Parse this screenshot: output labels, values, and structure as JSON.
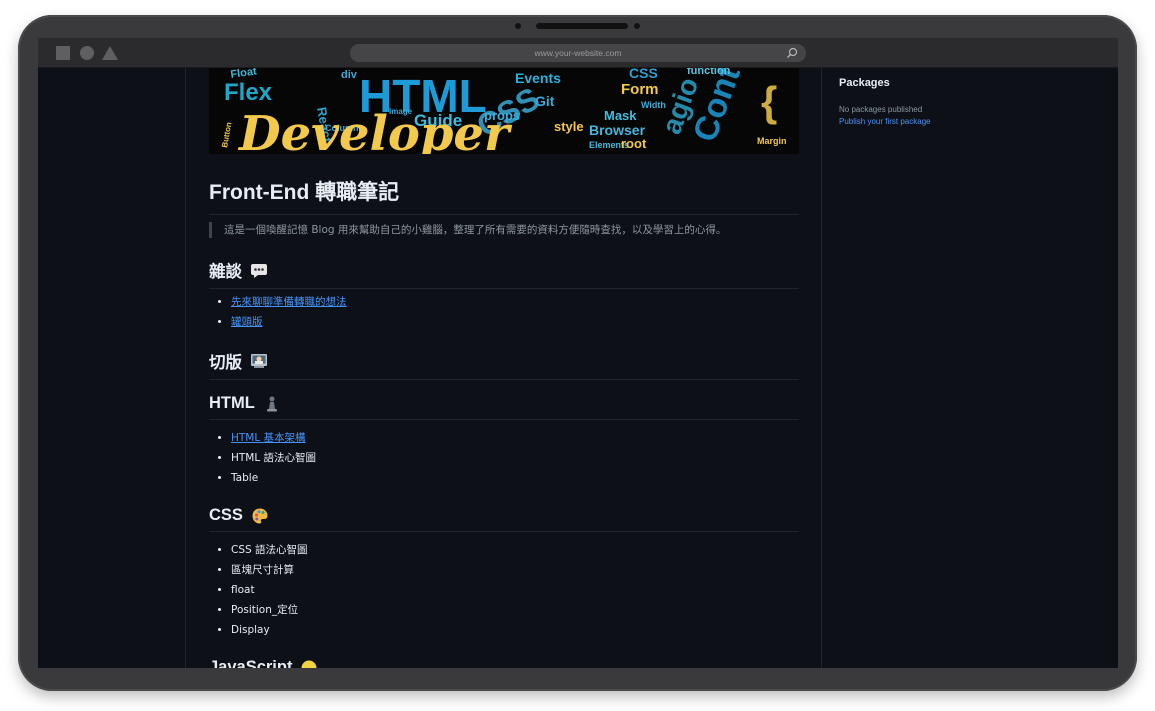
{
  "browser": {
    "url": "www.your-website.com"
  },
  "article": {
    "banner_words": [
      "HTML",
      "Flex",
      "Float",
      "div",
      "Events",
      "CSS",
      "Form",
      "function",
      "React",
      "Guide",
      "props",
      "style",
      "Mask",
      "Browser",
      "Elements",
      "root",
      "Margin",
      "Image",
      "Git",
      "Width",
      "Column",
      "Button",
      "Developer"
    ],
    "title": "Front-End 轉職筆記",
    "intro": "這是一個喚醒記憶 Blog 用來幫助自己的小雞腦，整理了所有需要的資料方便隨時查找，以及學習上的心得。",
    "sections": [
      {
        "heading": "雜談",
        "icon": "speech-bubble-icon",
        "items": [
          {
            "text": "先來聊聊準備轉職的想法",
            "link": true
          },
          {
            "text": "罐頭版",
            "link": true
          }
        ]
      },
      {
        "heading": "切版",
        "icon": "computer-person-icon",
        "items": []
      },
      {
        "heading": "HTML",
        "icon": "chess-pawn-icon",
        "items": [
          {
            "text": "HTML 基本架構",
            "link": true
          },
          {
            "text": "HTML 語法心智圖",
            "link": false
          },
          {
            "text": "Table",
            "link": false
          }
        ]
      },
      {
        "heading": "CSS",
        "icon": "palette-icon",
        "items": [
          {
            "text": "CSS 語法心智圖",
            "link": false
          },
          {
            "text": "區塊尺寸計算",
            "link": false
          },
          {
            "text": "float",
            "link": false
          },
          {
            "text": "Position_定位",
            "link": false
          },
          {
            "text": "Display",
            "link": false
          }
        ]
      },
      {
        "heading": "JavaScript",
        "icon": "yellow-circle-icon",
        "items": []
      }
    ]
  },
  "sidebar": {
    "title": "Packages",
    "empty_text": "No packages published",
    "link_text": "Publish your first package"
  },
  "colors": {
    "background": "#0d1117",
    "text": "#e6edf3",
    "muted": "#8d96a0",
    "link": "#4493f8",
    "border": "#21262d"
  }
}
